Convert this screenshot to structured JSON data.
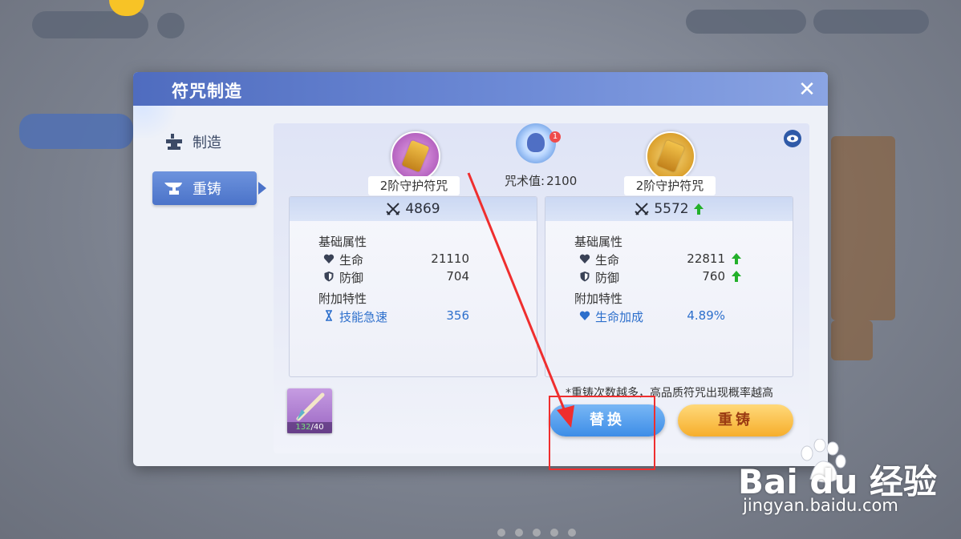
{
  "dialog": {
    "title": "符咒制造",
    "close_symbol": "✕"
  },
  "tabs": [
    {
      "label": "制造",
      "icon": "anvil-icon",
      "active": false
    },
    {
      "label": "重铸",
      "icon": "anvil-icon",
      "active": true
    }
  ],
  "current_rune": {
    "name": "2阶守护符咒",
    "power": "4869",
    "base_title": "基础属性",
    "stats": [
      {
        "icon": "heart-icon",
        "label": "生命",
        "value": "21110"
      },
      {
        "icon": "shield-icon",
        "label": "防御",
        "value": "704"
      }
    ],
    "extra_title": "附加特性",
    "extra": [
      {
        "icon": "hourglass-icon",
        "label": "技能急速",
        "value": "356"
      }
    ]
  },
  "new_rune": {
    "name": "2阶守护符咒",
    "power": "5572",
    "power_up": true,
    "base_title": "基础属性",
    "stats": [
      {
        "icon": "heart-icon",
        "label": "生命",
        "value": "22811",
        "up": true
      },
      {
        "icon": "shield-icon",
        "label": "防御",
        "value": "760",
        "up": true
      }
    ],
    "extra_title": "附加特性",
    "extra": [
      {
        "icon": "heart-icon",
        "label": "生命加成",
        "value": "4.89%"
      }
    ]
  },
  "spell_value": {
    "label": "咒术值:",
    "value": "2100",
    "badge": "1"
  },
  "material": {
    "count": "132",
    "total": "/40"
  },
  "hint": "*重铸次数越多，高品质符咒出现概率越高",
  "buttons": {
    "replace": "替换",
    "recast": "重铸"
  },
  "watermark": {
    "brand": "Bai du 经验",
    "url": "jingyan.baidu.com"
  },
  "colors": {
    "title_bar": "#5a78c8",
    "active_tab": "#4b73c9",
    "replace_button": "#3d8de7",
    "recast_button": "#f6ae2c",
    "stat_up_arrow": "#23b02a",
    "annotation": "#ef2e2e"
  }
}
